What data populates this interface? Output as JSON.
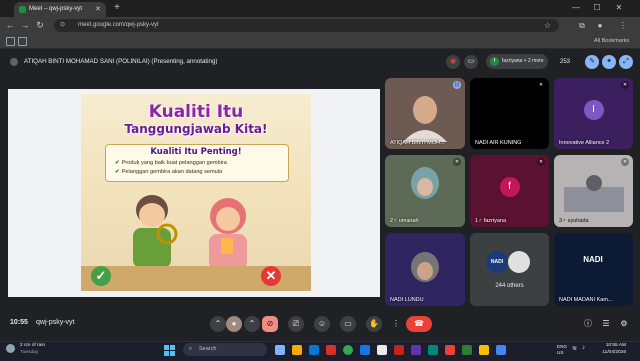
{
  "browser": {
    "tab_title": "Meet – qwj-psky-vyt",
    "url": "meet.google.com/qwj-psky-vyt",
    "all_bookmarks": "All Bookmarks"
  },
  "meet": {
    "presenting_text": "ATIQAH BINTI MOHAMAD SANI (POLINILAI) (Presenting, annotating)",
    "participants_pill": "fazriyana + 2 more",
    "people_count": "253",
    "time": "10:55",
    "meeting_code": "qwj-psky-vyt"
  },
  "slide": {
    "title_line1": "Kualiti Itu",
    "title_line2": "Tanggungjawab Kita!",
    "subtitle": "Kualiti Itu Penting!",
    "bullets": [
      "Produk yang baik buat pelanggan gembira",
      "Pelanggan gembira akan datang semula"
    ]
  },
  "tiles": [
    {
      "name": "ATIQAH BINTI MOH...",
      "color": "#6d5a52"
    },
    {
      "name": "NADI AIR KUNING",
      "color": "#000000"
    },
    {
      "name": "Innovative Alliance 2",
      "color": "#3b1f5f",
      "initial": "I",
      "avatar_color": "#7e57c2"
    },
    {
      "name": "2♂ umairah",
      "color": "#5d6a56"
    },
    {
      "name": "1♂ fazriyana",
      "color": "#5b1230",
      "initial": "f",
      "avatar_color": "#c2185b"
    },
    {
      "name": "3♂ syuhada",
      "color": "#b7b2b4"
    },
    {
      "name": "NADI LUNDU",
      "color": "#2f2560"
    },
    {
      "name": "244 others",
      "color": "#3c4043",
      "badge": "NADI"
    },
    {
      "name": "NADI MADANI Kam...",
      "color": "#0d1a33",
      "badge": "NADI"
    }
  ],
  "taskbar": {
    "weather_line1": "2 cm of rain",
    "weather_line2": "Tuesday",
    "search_placeholder": "Search",
    "lang_line1": "ENG",
    "lang_line2": "US",
    "time": "10:55 AM",
    "date": "11/04/2026"
  },
  "colors": {
    "accent_red": "#ea4335",
    "meet_bg": "#202124"
  }
}
